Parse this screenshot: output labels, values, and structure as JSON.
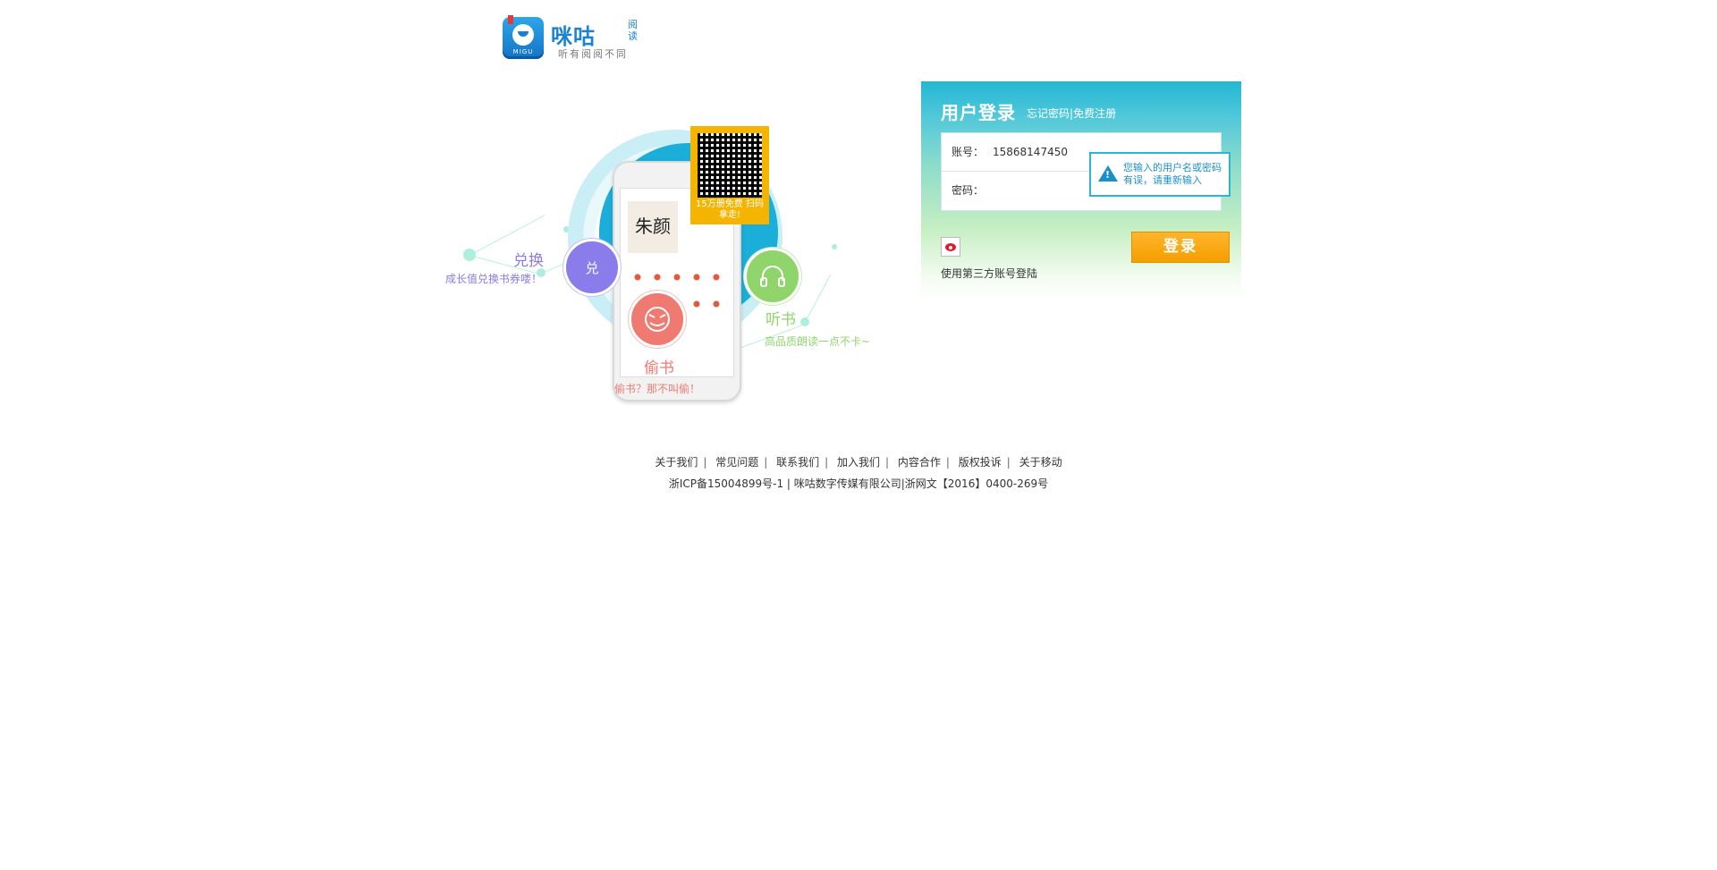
{
  "brand": {
    "app_label": "MIGU",
    "name": "咪咕",
    "sub": "阅读",
    "slogan": "听有阅阅不同"
  },
  "illustration": {
    "qr_caption": "15万册免费 扫码拿走!",
    "book_title": "朱颜",
    "features": [
      {
        "title": "兑换",
        "desc": "成长值兑换书券喽！",
        "badge": "兑",
        "color": "#8a7cea"
      },
      {
        "title": "听书",
        "desc": "高品质朗读一点不卡~",
        "color": "#8fd56c"
      },
      {
        "title": "偷书",
        "desc": "偷书？那不叫偷！",
        "color": "#ef7a72"
      }
    ]
  },
  "login": {
    "title": "用户登录",
    "forgot_link": "忘记密码",
    "link_separator": "|",
    "register_link": "免费注册",
    "account_label": "账号：",
    "account_value": "15868147450",
    "password_label": "密码：",
    "error_tip": "您输入的用户名或密码有误，请重新输入",
    "third_party_text": "使用第三方账号登陆",
    "submit_label": "登录",
    "accent_color": "#23b7d3",
    "button_color": "#f5a000"
  },
  "footer": {
    "links": [
      "关于我们",
      "常见问题",
      "联系我们",
      "加入我们",
      "内容合作",
      "版权投诉",
      "关于移动"
    ],
    "copyright": "浙ICP备15004899号-1 | 咪咕数字传媒有限公司|浙网文【2016】0400-269号"
  }
}
